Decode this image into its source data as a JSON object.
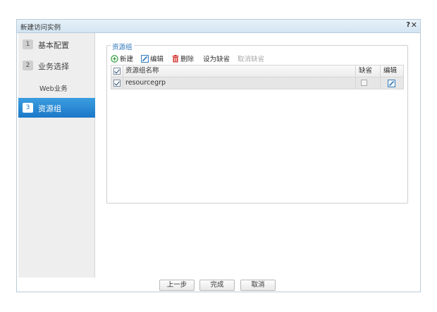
{
  "dialog": {
    "title": "新建访问实例",
    "help_label": "?",
    "close_label": "✕"
  },
  "sidebar": {
    "steps": [
      {
        "num": "1",
        "label": "基本配置"
      },
      {
        "num": "2",
        "label": "业务选择"
      },
      {
        "num": "3",
        "label": "资源组"
      }
    ],
    "substeps": [
      "Web业务"
    ]
  },
  "fieldset": {
    "legend": "资源组"
  },
  "toolbar": {
    "new_label": "新建",
    "edit_label": "编辑",
    "delete_label": "删除",
    "set_default_label": "设为缺省",
    "cancel_default_label": "取消缺省"
  },
  "grid": {
    "headers": {
      "name": "资源组名称",
      "default": "缺省",
      "edit": "编辑"
    },
    "rows": [
      {
        "name": "resourcegrp",
        "checked": true,
        "default": false
      }
    ]
  },
  "footer": {
    "prev_label": "上一步",
    "finish_label": "完成",
    "cancel_label": "取消"
  },
  "colors": {
    "accent": "#1c78c8",
    "delete": "#d0302a",
    "new": "#2e9b3a"
  }
}
